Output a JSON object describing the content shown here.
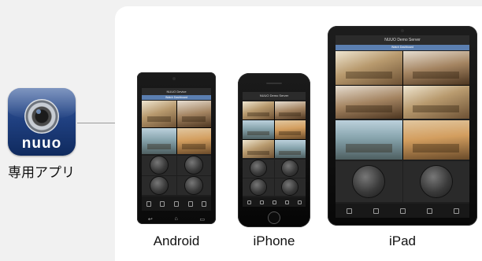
{
  "app": {
    "brand": "nuuo",
    "caption": "専用アプリ"
  },
  "devices": {
    "android": {
      "label": "Android",
      "screen_title": "NUUO Device",
      "tab": "Watch Dashboard"
    },
    "iphone": {
      "label": "iPhone",
      "screen_title": "NUUO Demo Server",
      "tab": ""
    },
    "ipad": {
      "label": "iPad",
      "screen_title": "NUUO Demo Server",
      "tab": "Watch Dashboard"
    }
  },
  "icons": [
    "camera-lens-icon",
    "home-button-icon"
  ],
  "colors": {
    "accent": "#5b7fb1",
    "icon_blue": "#1f3f7f"
  }
}
